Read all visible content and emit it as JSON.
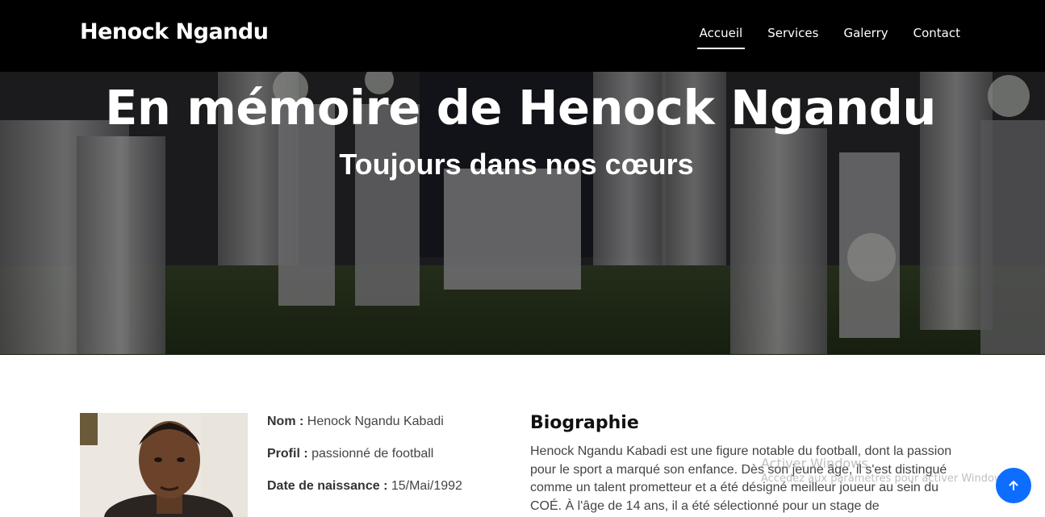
{
  "brand": {
    "name": "Henock Ngandu"
  },
  "nav": {
    "items": [
      {
        "label": "Accueil",
        "active": true
      },
      {
        "label": "Services",
        "active": false
      },
      {
        "label": "Galerry",
        "active": false
      },
      {
        "label": "Contact",
        "active": false
      }
    ]
  },
  "hero": {
    "title": "En mémoire de Henock Ngandu",
    "subtitle": "Toujours dans nos cœurs"
  },
  "profile": {
    "rows": [
      {
        "label": "Nom :",
        "value": "Henock Ngandu Kabadi"
      },
      {
        "label": "Profil :",
        "value": "passionné de football"
      },
      {
        "label": "Date de naissance :",
        "value": "15/Mai/1992"
      }
    ]
  },
  "biography": {
    "title": "Biographie",
    "lines": [
      "Henock Ngandu Kabadi est une figure notable du football, dont la passion",
      "pour le sport a marqué son enfance. Dès son jeune âge, il s'est distingué",
      "comme un talent prometteur et a été désigné meilleur joueur au sein du",
      "COÉ. À l'âge de 14 ans, il a été sélectionné pour un stage de"
    ]
  },
  "watermark": {
    "line1": "Activer Windows",
    "line2": "Accédez aux paramètres pour activer Windows."
  },
  "colors": {
    "navbar": "#000000",
    "accent": "#0d6efd"
  }
}
